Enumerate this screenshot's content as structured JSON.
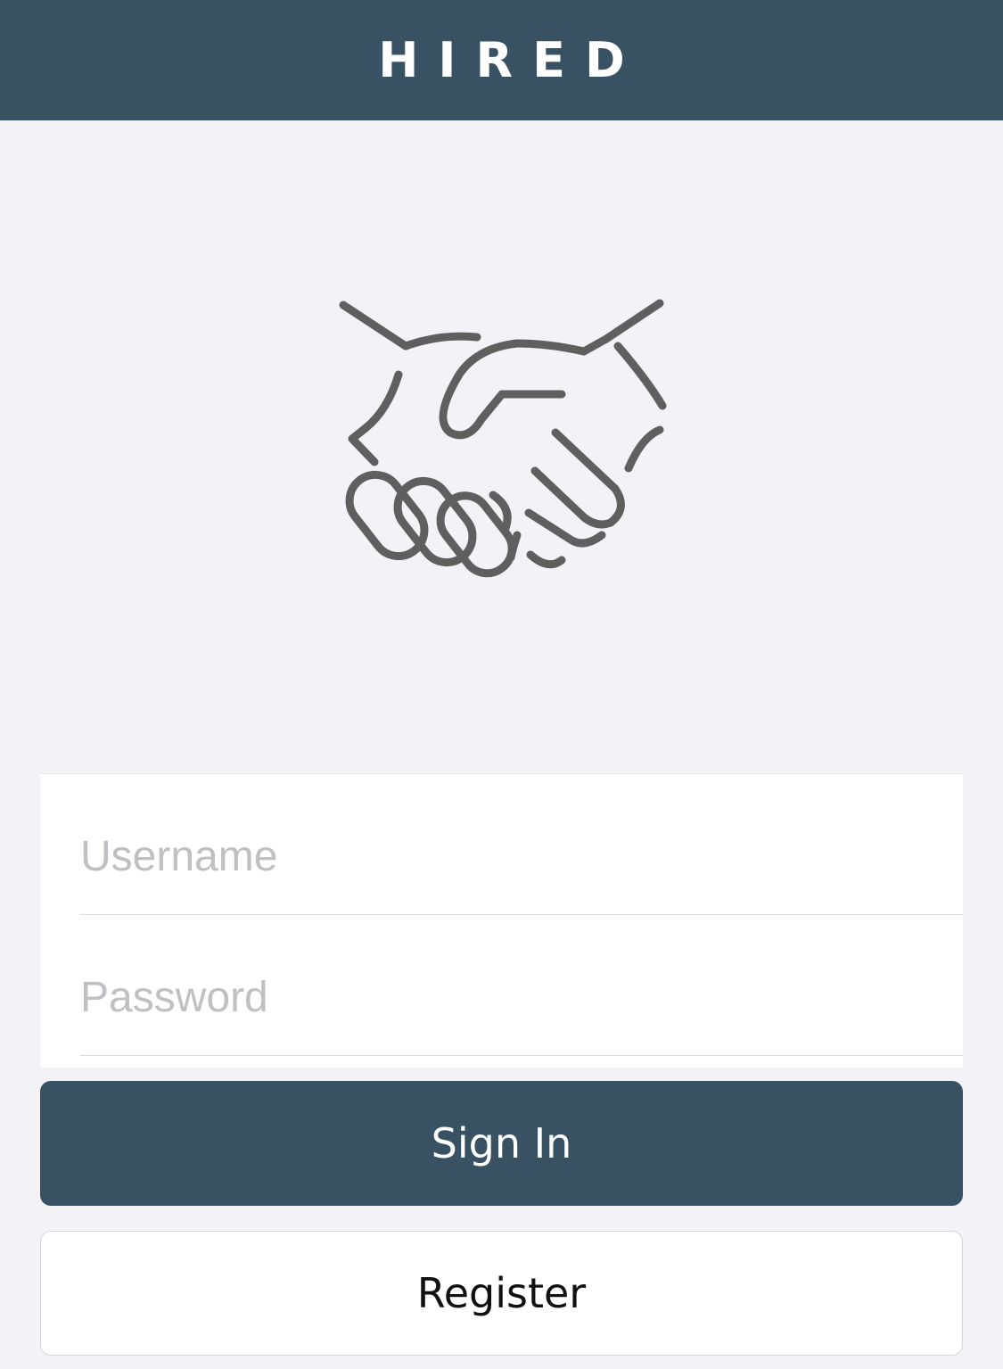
{
  "app": {
    "title": "HIRED"
  },
  "logo": {
    "icon": "handshake-icon",
    "color": "#5f5f5f"
  },
  "form": {
    "username": {
      "placeholder": "Username",
      "value": ""
    },
    "password": {
      "placeholder": "Password",
      "value": ""
    }
  },
  "actions": {
    "sign_in_label": "Sign In",
    "register_label": "Register"
  },
  "colors": {
    "primary": "#385263",
    "background": "#f3f3f7",
    "card": "#ffffff"
  }
}
